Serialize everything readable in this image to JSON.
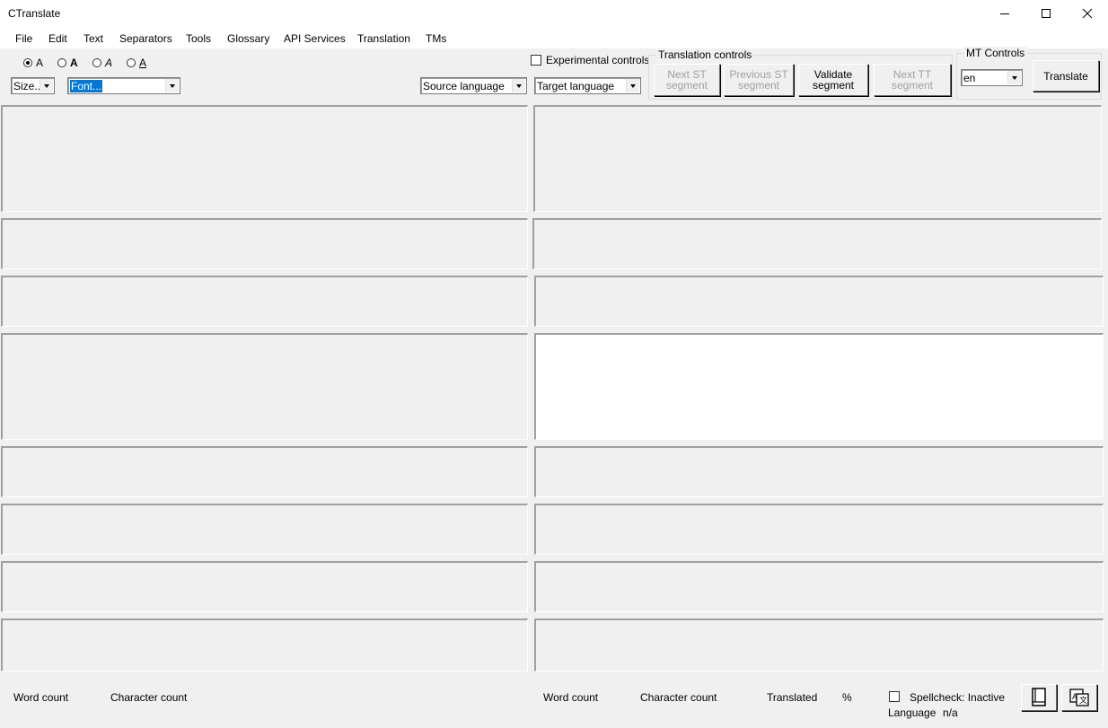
{
  "window": {
    "title": "CTranslate",
    "controls": [
      "minimize-icon",
      "maximize-icon",
      "close-icon"
    ]
  },
  "menu": [
    "File",
    "Edit",
    "Text",
    "Separators",
    "Tools",
    "Glossary",
    "API Services",
    "Translation",
    "TMs"
  ],
  "format_radios": [
    {
      "label": "A",
      "style": "normal",
      "checked": true
    },
    {
      "label": "A",
      "style": "bold",
      "checked": false
    },
    {
      "label": "A",
      "style": "italic",
      "checked": false
    },
    {
      "label": "A",
      "style": "underline",
      "checked": false
    }
  ],
  "size_combo": {
    "value": "Size..."
  },
  "font_combo": {
    "value": "Font..."
  },
  "source_language": {
    "value": "Source language"
  },
  "target_language": {
    "value": "Target language"
  },
  "experimental_controls": {
    "label": "Experimental controls",
    "checked": false
  },
  "translation_controls": {
    "title": "Translation controls",
    "buttons": [
      {
        "line1": "Next ST",
        "line2": "segment",
        "enabled": false
      },
      {
        "line1": "Previous ST",
        "line2": "segment",
        "enabled": false
      },
      {
        "line1": "Validate",
        "line2": "segment",
        "enabled": true
      },
      {
        "line1": "Next TT",
        "line2": "segment",
        "enabled": false
      }
    ]
  },
  "mt_controls": {
    "title": "MT Controls",
    "language": "en",
    "translate_label": "Translate"
  },
  "panes": {
    "active_row": 3,
    "active_side": "target",
    "row_count": 8
  },
  "status": {
    "left_word_count": "Word count",
    "left_char_count": "Character count",
    "right_word_count": "Word count",
    "right_char_count": "Character count",
    "translated_label": "Translated",
    "percent": "%",
    "spellcheck_label": "Spellcheck: Inactive",
    "spellcheck_checked": false,
    "language_label": "Language",
    "language_value": "n/a"
  },
  "accent_colors": {
    "selection": "#0078d7",
    "pane_bg": "#f0f0f0",
    "active_pane_bg": "#ffffff"
  }
}
